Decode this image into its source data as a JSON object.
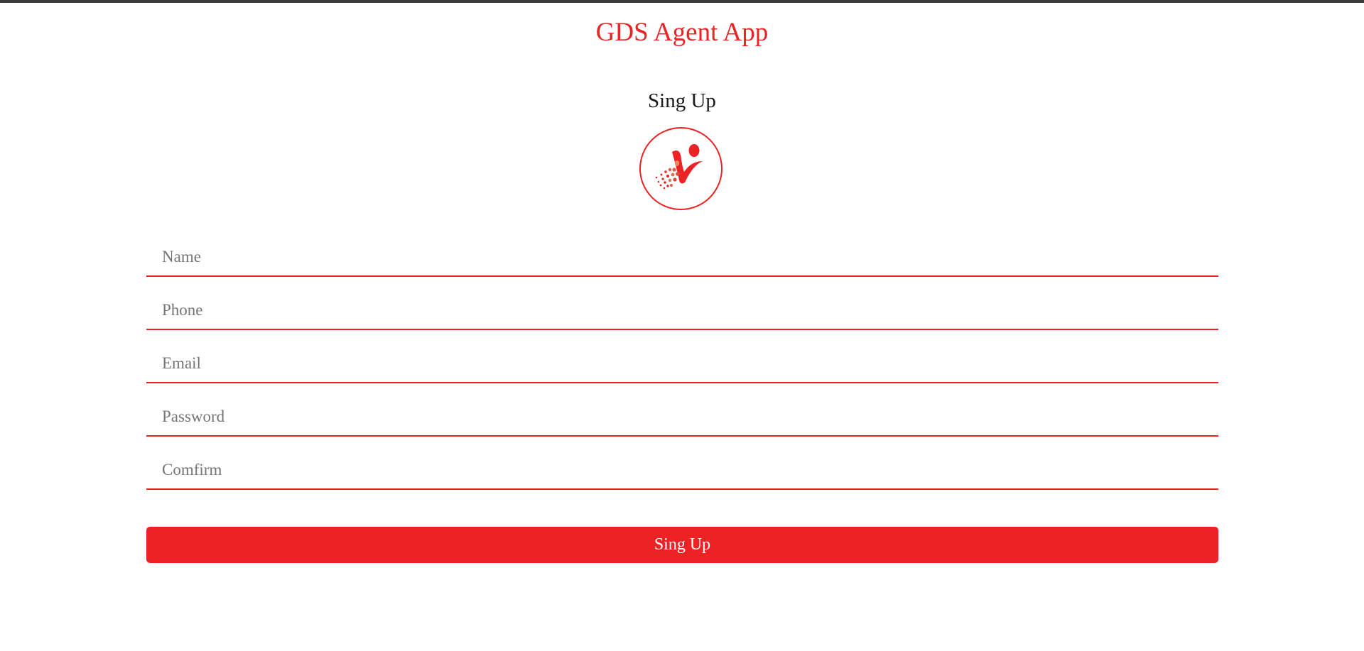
{
  "app": {
    "title": "GDS Agent App"
  },
  "signup": {
    "heading": "Sing Up",
    "logo_icon": "person-dots-logo-icon",
    "fields": {
      "name": {
        "placeholder": "Name",
        "value": ""
      },
      "phone": {
        "placeholder": "Phone",
        "value": ""
      },
      "email": {
        "placeholder": "Email",
        "value": ""
      },
      "password": {
        "placeholder": "Password",
        "value": ""
      },
      "confirm": {
        "placeholder": "Comfirm",
        "value": ""
      }
    },
    "submit_label": "Sing Up"
  },
  "colors": {
    "accent": "#ed2224",
    "top_bar": "#3a3a3a",
    "heading_text": "#1a1a1a",
    "placeholder_text": "#757575"
  }
}
